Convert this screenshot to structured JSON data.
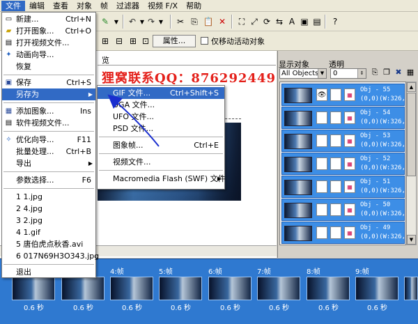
{
  "menubar": {
    "items": [
      "文件",
      "编辑",
      "查看",
      "对象",
      "帧",
      "过滤器",
      "视频 F/X",
      "帮助"
    ]
  },
  "toolbar": {
    "properties_label": "属性...",
    "move_active_label": "仅移动活动对象"
  },
  "canvas": {
    "tab_label": "览"
  },
  "watermark": "狸窝联系QQ：876292449",
  "file_menu": {
    "items": [
      {
        "label": "新建...",
        "shortcut": "Ctrl+N",
        "icon": "new-icon"
      },
      {
        "label": "打开图象...",
        "shortcut": "Ctrl+O",
        "icon": "open-icon"
      },
      {
        "label": "打开视频文件...",
        "shortcut": "",
        "icon": "open-video-icon"
      },
      {
        "label": "动画向导...",
        "shortcut": "",
        "icon": "wizard-icon"
      },
      {
        "label": "恢复",
        "shortcut": "",
        "icon": ""
      },
      {
        "label": "保存",
        "shortcut": "Ctrl+S",
        "icon": "save-icon"
      },
      {
        "label": "另存为",
        "shortcut": "",
        "icon": ""
      },
      {
        "label": "添加图象...",
        "shortcut": "Ins",
        "icon": "add-image-icon"
      },
      {
        "label": "软件视频文件...",
        "shortcut": "",
        "icon": "video-file-icon"
      },
      {
        "label": "优化向导...",
        "shortcut": "F11",
        "icon": "optimize-icon"
      },
      {
        "label": "批量处理...",
        "shortcut": "Ctrl+B",
        "icon": ""
      },
      {
        "label": "导出",
        "shortcut": "",
        "icon": ""
      },
      {
        "label": "参数选择...",
        "shortcut": "F6",
        "icon": ""
      },
      {
        "label": "1 1.jpg",
        "shortcut": "",
        "icon": ""
      },
      {
        "label": "2 4.jpg",
        "shortcut": "",
        "icon": ""
      },
      {
        "label": "3 2.jpg",
        "shortcut": "",
        "icon": ""
      },
      {
        "label": "4 1.gif",
        "shortcut": "",
        "icon": ""
      },
      {
        "label": "5 唐伯虎点秋香.avi",
        "shortcut": "",
        "icon": ""
      },
      {
        "label": "6 017N69H3O343.jpg",
        "shortcut": "",
        "icon": ""
      },
      {
        "label": "退出",
        "shortcut": "",
        "icon": ""
      }
    ]
  },
  "save_as_menu": {
    "items": [
      {
        "label": "GIF 文件...",
        "shortcut": "Ctrl+Shift+S"
      },
      {
        "label": "UGA 文件...",
        "shortcut": ""
      },
      {
        "label": "UFO 文件...",
        "shortcut": ""
      },
      {
        "label": "PSD 文件...",
        "shortcut": ""
      },
      {
        "label": "图象帧...",
        "shortcut": "Ctrl+E"
      },
      {
        "label": "视频文件...",
        "shortcut": ""
      },
      {
        "label": "Macromedia Flash (SWF) 文件",
        "shortcut": ""
      }
    ]
  },
  "object_panel": {
    "show_label": "显示对象",
    "transparency_label": "透明",
    "filter_value": "All Objects",
    "transparency_value": "0",
    "objects": [
      {
        "line1": "Obj - 55",
        "line2": "(0,0)(W:326,H:"
      },
      {
        "line1": "Obj - 54",
        "line2": "(0,0)(W:326,H:"
      },
      {
        "line1": "Obj - 53",
        "line2": "(0,0)(W:326,H:"
      },
      {
        "line1": "Obj - 52",
        "line2": "(0,0)(W:326,H:"
      },
      {
        "line1": "Obj - 51",
        "line2": "(0,0)(W:326,H:"
      },
      {
        "line1": "Obj - 50",
        "line2": "(0,0)(W:326,H:"
      },
      {
        "line1": "Obj - 49",
        "line2": "(0,0)(W:326,H:"
      }
    ]
  },
  "frames": [
    {
      "label": "",
      "time": "0.6 秒"
    },
    {
      "label": "",
      "time": "0.6 秒"
    },
    {
      "label": "4:帧",
      "time": "0.6 秒"
    },
    {
      "label": "5:帧",
      "time": "0.6 秒"
    },
    {
      "label": "6:帧",
      "time": "0.6 秒"
    },
    {
      "label": "7:帧",
      "time": "0.6 秒"
    },
    {
      "label": "8:帧",
      "time": "0.6 秒"
    },
    {
      "label": "9:帧",
      "time": "0.6 秒"
    },
    {
      "label": "",
      "time": ""
    }
  ],
  "colors": {
    "highlight": "#316ac5",
    "frame_strip": "#2f79d0",
    "watermark": "#e4201a"
  }
}
